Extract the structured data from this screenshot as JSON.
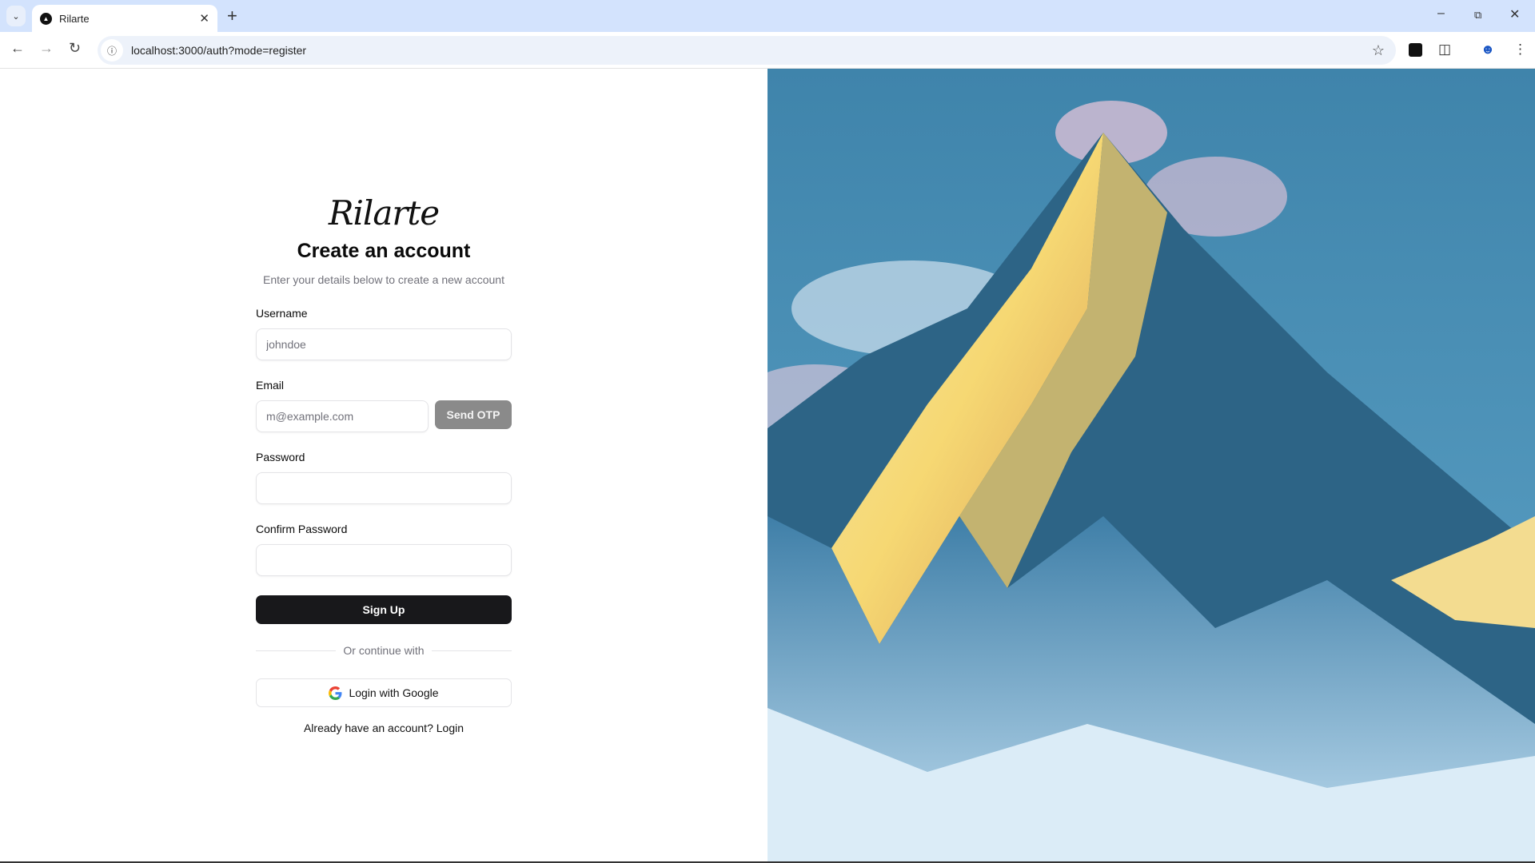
{
  "browser": {
    "tab_title": "Rilarte",
    "new_tab_label": "+",
    "url": "localhost:3000/auth?mode=register",
    "icons": [
      "tab-list-icon",
      "favicon",
      "close-icon",
      "back-icon",
      "forward-icon",
      "reload-icon",
      "site-info-icon",
      "bookmark-star-icon",
      "extension-icon",
      "puzzle-extensions-icon",
      "profile-icon",
      "menu-icon",
      "minimize-icon",
      "restore-icon",
      "window-close-icon"
    ]
  },
  "auth": {
    "logo": "Rilarte",
    "title": "Create an account",
    "subtitle": "Enter your details below to create a new account",
    "username_label": "Username",
    "username_placeholder": "johndoe",
    "email_label": "Email",
    "email_placeholder": "m@example.com",
    "send_otp": "Send OTP",
    "password_label": "Password",
    "confirm_label": "Confirm Password",
    "signup": "Sign Up",
    "divider": "Or continue with",
    "google": "Login with Google",
    "already": "Already have an account?",
    "login_link": "Login"
  },
  "colors": {
    "primary": "#18181b",
    "send_otp_disabled": "#8a8a8a",
    "muted_text": "#71717a",
    "tabbar": "#d3e3fd"
  }
}
